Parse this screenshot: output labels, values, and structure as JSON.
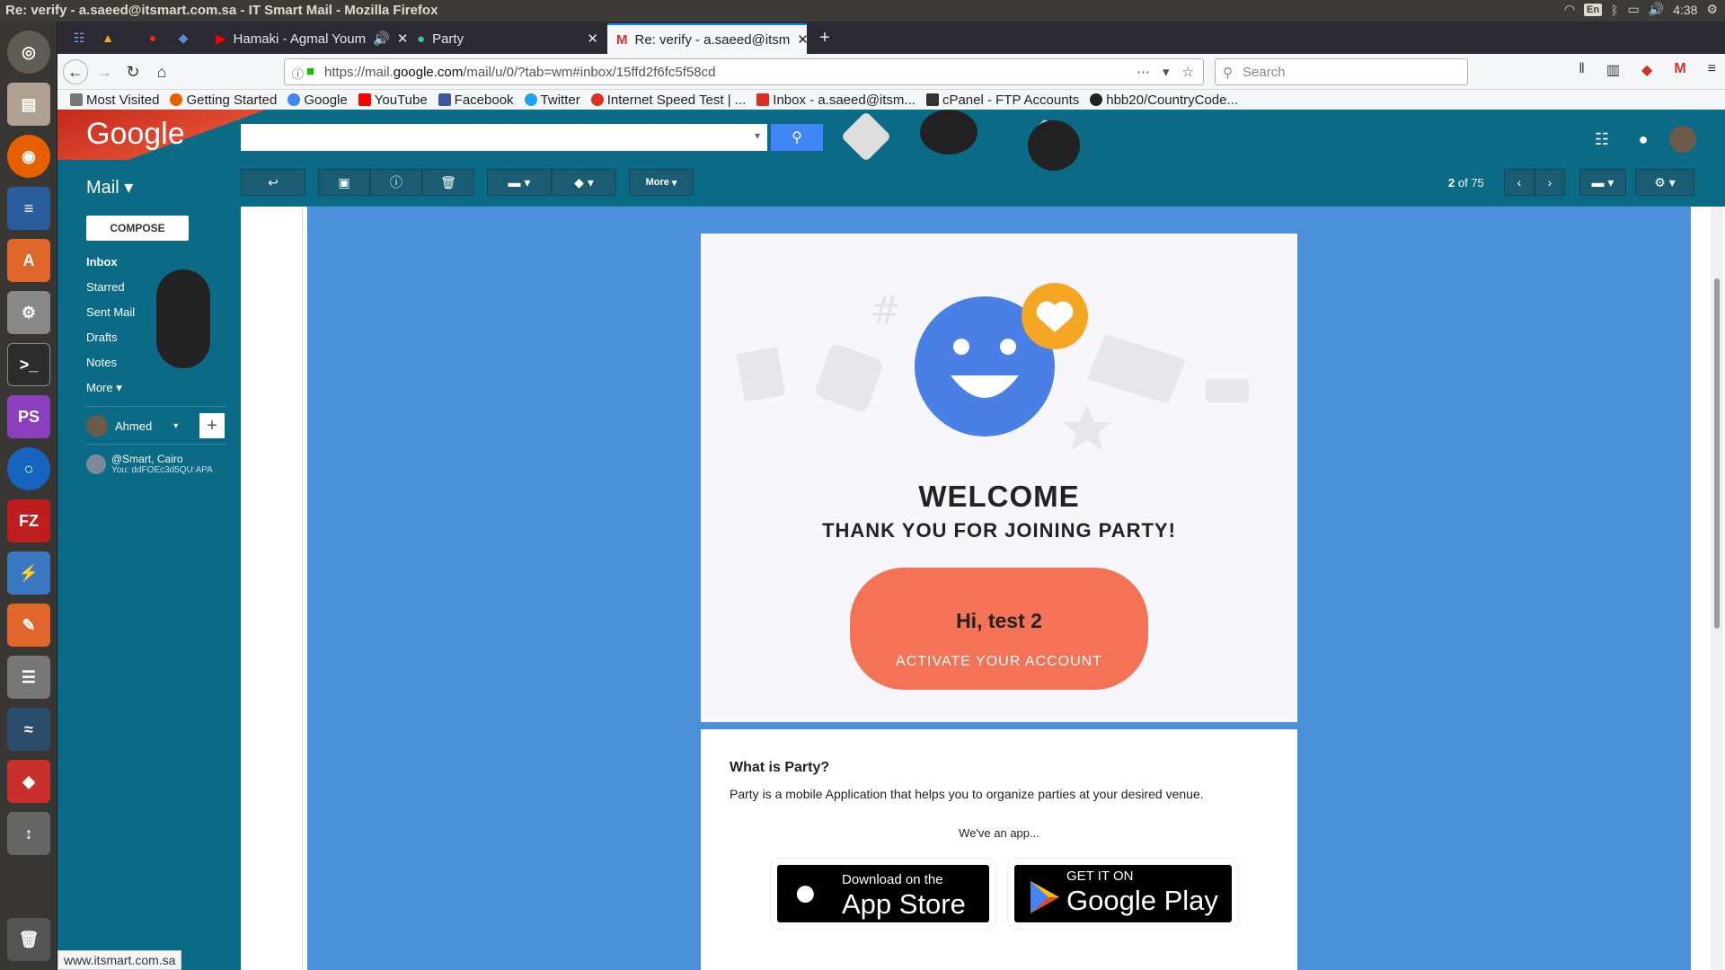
{
  "window_title": "Re: verify - a.saeed@itsmart.com.sa - IT Smart Mail - Mozilla Firefox",
  "os": {
    "lang": "En",
    "time": "‫4:38‬"
  },
  "tabs": [
    {
      "label": "Hamaki - Agmal Youm"
    },
    {
      "label": "Party"
    },
    {
      "label": "Re: verify - a.saeed@itsm"
    }
  ],
  "url": {
    "prefix": "https://mail.",
    "domain": "google.com",
    "path": "/mail/u/0/?tab=wm#inbox/15ffd2f6fc5f58cd"
  },
  "search_placeholder": "Search",
  "bookmarks": [
    {
      "label": "Most Visited",
      "color": "#777777"
    },
    {
      "label": "Getting Started",
      "color": "#e66000"
    },
    {
      "label": "Google",
      "color": "#4285f4"
    },
    {
      "label": "YouTube",
      "color": "#ff0000"
    },
    {
      "label": "Facebook",
      "color": "#3b5998"
    },
    {
      "label": "Twitter",
      "color": "#1da1f2"
    },
    {
      "label": "Internet Speed Test | ...",
      "color": "#e0301e"
    },
    {
      "label": "Inbox - a.saeed@itsm...",
      "color": "#d93025"
    },
    {
      "label": "cPanel - FTP Accounts",
      "color": "#333333"
    },
    {
      "label": "hbb20/CountryCode...",
      "color": "#222222"
    }
  ],
  "gmail": {
    "logo": "Google",
    "mail_label": "Mail",
    "more_label": "More",
    "pager": {
      "current": "2",
      "of_label": "of 75"
    },
    "compose": "COMPOSE",
    "nav": [
      "Inbox",
      "Starred",
      "Sent Mail",
      "Drafts",
      "Notes",
      "More"
    ],
    "chat_user": "Ahmed",
    "hangout": {
      "name": "@Smart, Cairo",
      "snippet": "You: ddFOEc3d5QU:APA"
    }
  },
  "email": {
    "welcome": "WELCOME",
    "thanks": "THANK YOU FOR JOINING PARTY!",
    "greeting": "Hi, test 2",
    "activate": "ACTIVATE YOUR ACCOUNT",
    "what_title": "What is Party?",
    "what_desc": "Party is a mobile Application that helps you to organize parties at your desired venue.",
    "app_note": "We've an app...",
    "app_store": {
      "small": "Download on the",
      "big": "App Store"
    },
    "google_play": {
      "small": "GET IT ON",
      "big": "Google Play"
    }
  },
  "status_url": "www.itsmart.com.sa",
  "colors": {
    "gmail_header": "#0b6b86",
    "email_bg": "#4a90d9",
    "activate_btn": "#f47356",
    "smiley": "#4a7fe6",
    "heart_badge": "#f5a623"
  }
}
